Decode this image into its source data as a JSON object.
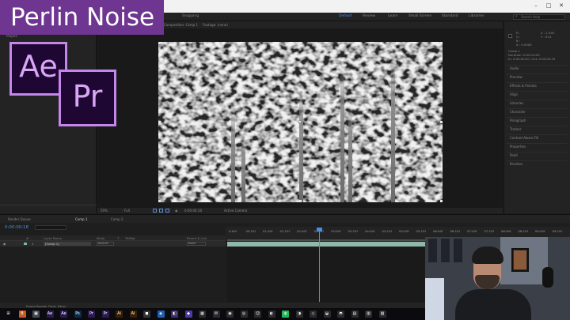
{
  "banner": {
    "title": "Perlin Noise"
  },
  "logos": {
    "ae": "Ae",
    "pr": "Pr"
  },
  "window_controls": {
    "minimize": "–",
    "maximize": "□",
    "close": "✕"
  },
  "toolbar": {
    "snapping": "Snapping",
    "workspaces": [
      "Default",
      "Review",
      "Learn",
      "Small Screen",
      "Standard",
      "Libraries"
    ],
    "active_workspace": "Default",
    "search_placeholder": "Search Help"
  },
  "left_panel": {
    "tab": "Project"
  },
  "composition": {
    "tabs": [
      "Composition: Comp 1",
      "Footage: (none)"
    ],
    "zoom": "50%",
    "resolution": "Full",
    "timecode": "0:00:00:18",
    "camera": "Active Camera"
  },
  "info_panel": {
    "lines": [
      "R :",
      "G :",
      "B :",
      "A : 0.0000",
      "X : 1.540",
      "Y : 514",
      "Comp 1",
      "Duration: 0:00:10:00",
      "In: 0:00:00:00, Out: 0:00:09:29"
    ]
  },
  "right_panel": {
    "items": [
      "Audio",
      "Preview",
      "Effects & Presets",
      "Align",
      "Libraries",
      "Character",
      "Paragraph",
      "Tracker",
      "Content-Aware Fill",
      "Properties",
      "Paint",
      "Brushes"
    ]
  },
  "timeline": {
    "tabs": [
      "Render Queue",
      "Comp 1",
      "Comp 2"
    ],
    "active_tab": "Comp 1",
    "timecode": "0:00:00:18",
    "headers": [
      "#",
      "Layer Name",
      "Mode",
      "T",
      "TrkMat",
      "Parent & Link"
    ],
    "layer": {
      "index": "1",
      "name": "[Comp 1]",
      "mode": "Normal",
      "parent": "None"
    },
    "ruler_ticks": [
      "0:00f",
      "00:15f",
      "01:00f",
      "01:15f",
      "02:00f",
      "02:15f",
      "03:00f",
      "03:15f",
      "04:00f",
      "04:15f",
      "05:00f",
      "05:15f",
      "06:00f",
      "06:15f",
      "07:00f",
      "07:15f",
      "08:00f",
      "08:15f",
      "09:00f",
      "09:15f"
    ],
    "footer": "Frame Render Time: 49ms"
  },
  "taskbar": {
    "apps": [
      {
        "label": "⊞",
        "color": "#0b0b0f"
      },
      {
        "label": "B",
        "color": "#c85a1e"
      },
      {
        "label": "▣",
        "color": "#444a55"
      },
      {
        "label": "Ae",
        "color": "#2b1a52"
      },
      {
        "label": "Ae",
        "color": "#2b1a52"
      },
      {
        "label": "Ps",
        "color": "#0a2b4a"
      },
      {
        "label": "Pr",
        "color": "#2b1a52"
      },
      {
        "label": "Pr",
        "color": "#2b1a52"
      },
      {
        "label": "Ai",
        "color": "#3a1f00"
      },
      {
        "label": "Ai",
        "color": "#3a1f00"
      },
      {
        "label": "◼",
        "color": "#333"
      },
      {
        "label": "◈",
        "color": "#1f5fb5"
      },
      {
        "label": "◧",
        "color": "#3a2f6b"
      },
      {
        "label": "◆",
        "color": "#4a3aa8"
      },
      {
        "label": "▦",
        "color": "#2a2a2a"
      },
      {
        "label": "✉",
        "color": "#2a2a2a"
      },
      {
        "label": "◉",
        "color": "#2a2a2a"
      },
      {
        "label": "◎",
        "color": "#2a2a2a"
      },
      {
        "label": "☺",
        "color": "#2a2a2a"
      },
      {
        "label": "◐",
        "color": "#2a2a2a"
      },
      {
        "label": "◍",
        "color": "#1db954"
      },
      {
        "label": "◑",
        "color": "#2a2a2a"
      },
      {
        "label": "◇",
        "color": "#2a2a2a"
      },
      {
        "label": "◒",
        "color": "#2a2a2a"
      },
      {
        "label": "◓",
        "color": "#2a2a2a"
      },
      {
        "label": "▤",
        "color": "#2a2a2a"
      },
      {
        "label": "▥",
        "color": "#2a2a2a"
      },
      {
        "label": "▧",
        "color": "#2a2a2a"
      }
    ]
  },
  "colors": {
    "accent": "#4a90e2",
    "banner": "#6e3591",
    "logo_border": "#c586ec"
  }
}
